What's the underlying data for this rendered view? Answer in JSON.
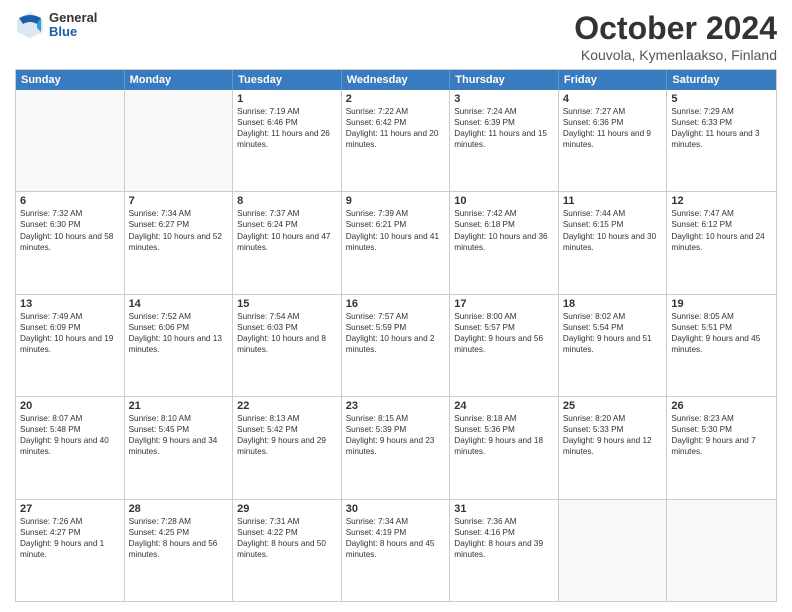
{
  "logo": {
    "general": "General",
    "blue": "Blue"
  },
  "title": "October 2024",
  "subtitle": "Kouvola, Kymenlaakso, Finland",
  "header_days": [
    "Sunday",
    "Monday",
    "Tuesday",
    "Wednesday",
    "Thursday",
    "Friday",
    "Saturday"
  ],
  "weeks": [
    [
      {
        "day": "",
        "sunrise": "",
        "sunset": "",
        "daylight": ""
      },
      {
        "day": "",
        "sunrise": "",
        "sunset": "",
        "daylight": ""
      },
      {
        "day": "1",
        "sunrise": "Sunrise: 7:19 AM",
        "sunset": "Sunset: 6:46 PM",
        "daylight": "Daylight: 11 hours and 26 minutes."
      },
      {
        "day": "2",
        "sunrise": "Sunrise: 7:22 AM",
        "sunset": "Sunset: 6:42 PM",
        "daylight": "Daylight: 11 hours and 20 minutes."
      },
      {
        "day": "3",
        "sunrise": "Sunrise: 7:24 AM",
        "sunset": "Sunset: 6:39 PM",
        "daylight": "Daylight: 11 hours and 15 minutes."
      },
      {
        "day": "4",
        "sunrise": "Sunrise: 7:27 AM",
        "sunset": "Sunset: 6:36 PM",
        "daylight": "Daylight: 11 hours and 9 minutes."
      },
      {
        "day": "5",
        "sunrise": "Sunrise: 7:29 AM",
        "sunset": "Sunset: 6:33 PM",
        "daylight": "Daylight: 11 hours and 3 minutes."
      }
    ],
    [
      {
        "day": "6",
        "sunrise": "Sunrise: 7:32 AM",
        "sunset": "Sunset: 6:30 PM",
        "daylight": "Daylight: 10 hours and 58 minutes."
      },
      {
        "day": "7",
        "sunrise": "Sunrise: 7:34 AM",
        "sunset": "Sunset: 6:27 PM",
        "daylight": "Daylight: 10 hours and 52 minutes."
      },
      {
        "day": "8",
        "sunrise": "Sunrise: 7:37 AM",
        "sunset": "Sunset: 6:24 PM",
        "daylight": "Daylight: 10 hours and 47 minutes."
      },
      {
        "day": "9",
        "sunrise": "Sunrise: 7:39 AM",
        "sunset": "Sunset: 6:21 PM",
        "daylight": "Daylight: 10 hours and 41 minutes."
      },
      {
        "day": "10",
        "sunrise": "Sunrise: 7:42 AM",
        "sunset": "Sunset: 6:18 PM",
        "daylight": "Daylight: 10 hours and 36 minutes."
      },
      {
        "day": "11",
        "sunrise": "Sunrise: 7:44 AM",
        "sunset": "Sunset: 6:15 PM",
        "daylight": "Daylight: 10 hours and 30 minutes."
      },
      {
        "day": "12",
        "sunrise": "Sunrise: 7:47 AM",
        "sunset": "Sunset: 6:12 PM",
        "daylight": "Daylight: 10 hours and 24 minutes."
      }
    ],
    [
      {
        "day": "13",
        "sunrise": "Sunrise: 7:49 AM",
        "sunset": "Sunset: 6:09 PM",
        "daylight": "Daylight: 10 hours and 19 minutes."
      },
      {
        "day": "14",
        "sunrise": "Sunrise: 7:52 AM",
        "sunset": "Sunset: 6:06 PM",
        "daylight": "Daylight: 10 hours and 13 minutes."
      },
      {
        "day": "15",
        "sunrise": "Sunrise: 7:54 AM",
        "sunset": "Sunset: 6:03 PM",
        "daylight": "Daylight: 10 hours and 8 minutes."
      },
      {
        "day": "16",
        "sunrise": "Sunrise: 7:57 AM",
        "sunset": "Sunset: 5:59 PM",
        "daylight": "Daylight: 10 hours and 2 minutes."
      },
      {
        "day": "17",
        "sunrise": "Sunrise: 8:00 AM",
        "sunset": "Sunset: 5:57 PM",
        "daylight": "Daylight: 9 hours and 56 minutes."
      },
      {
        "day": "18",
        "sunrise": "Sunrise: 8:02 AM",
        "sunset": "Sunset: 5:54 PM",
        "daylight": "Daylight: 9 hours and 51 minutes."
      },
      {
        "day": "19",
        "sunrise": "Sunrise: 8:05 AM",
        "sunset": "Sunset: 5:51 PM",
        "daylight": "Daylight: 9 hours and 45 minutes."
      }
    ],
    [
      {
        "day": "20",
        "sunrise": "Sunrise: 8:07 AM",
        "sunset": "Sunset: 5:48 PM",
        "daylight": "Daylight: 9 hours and 40 minutes."
      },
      {
        "day": "21",
        "sunrise": "Sunrise: 8:10 AM",
        "sunset": "Sunset: 5:45 PM",
        "daylight": "Daylight: 9 hours and 34 minutes."
      },
      {
        "day": "22",
        "sunrise": "Sunrise: 8:13 AM",
        "sunset": "Sunset: 5:42 PM",
        "daylight": "Daylight: 9 hours and 29 minutes."
      },
      {
        "day": "23",
        "sunrise": "Sunrise: 8:15 AM",
        "sunset": "Sunset: 5:39 PM",
        "daylight": "Daylight: 9 hours and 23 minutes."
      },
      {
        "day": "24",
        "sunrise": "Sunrise: 8:18 AM",
        "sunset": "Sunset: 5:36 PM",
        "daylight": "Daylight: 9 hours and 18 minutes."
      },
      {
        "day": "25",
        "sunrise": "Sunrise: 8:20 AM",
        "sunset": "Sunset: 5:33 PM",
        "daylight": "Daylight: 9 hours and 12 minutes."
      },
      {
        "day": "26",
        "sunrise": "Sunrise: 8:23 AM",
        "sunset": "Sunset: 5:30 PM",
        "daylight": "Daylight: 9 hours and 7 minutes."
      }
    ],
    [
      {
        "day": "27",
        "sunrise": "Sunrise: 7:26 AM",
        "sunset": "Sunset: 4:27 PM",
        "daylight": "Daylight: 9 hours and 1 minute."
      },
      {
        "day": "28",
        "sunrise": "Sunrise: 7:28 AM",
        "sunset": "Sunset: 4:25 PM",
        "daylight": "Daylight: 8 hours and 56 minutes."
      },
      {
        "day": "29",
        "sunrise": "Sunrise: 7:31 AM",
        "sunset": "Sunset: 4:22 PM",
        "daylight": "Daylight: 8 hours and 50 minutes."
      },
      {
        "day": "30",
        "sunrise": "Sunrise: 7:34 AM",
        "sunset": "Sunset: 4:19 PM",
        "daylight": "Daylight: 8 hours and 45 minutes."
      },
      {
        "day": "31",
        "sunrise": "Sunrise: 7:36 AM",
        "sunset": "Sunset: 4:16 PM",
        "daylight": "Daylight: 8 hours and 39 minutes."
      },
      {
        "day": "",
        "sunrise": "",
        "sunset": "",
        "daylight": ""
      },
      {
        "day": "",
        "sunrise": "",
        "sunset": "",
        "daylight": ""
      }
    ]
  ]
}
